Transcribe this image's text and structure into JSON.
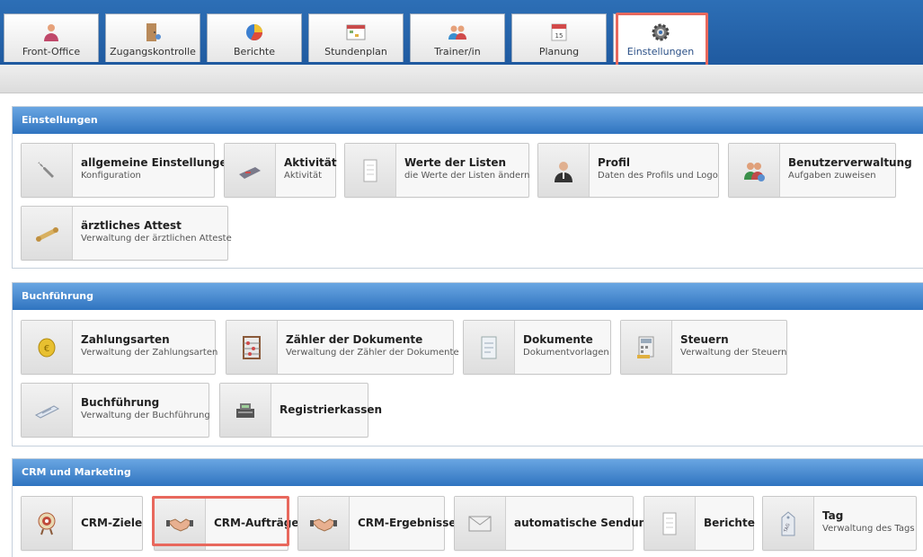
{
  "tabs": [
    {
      "label": "Front-Office",
      "icon": "person-icon"
    },
    {
      "label": "Zugangskontrolle",
      "icon": "door-icon"
    },
    {
      "label": "Berichte",
      "icon": "pie-chart-icon"
    },
    {
      "label": "Stundenplan",
      "icon": "schedule-icon"
    },
    {
      "label": "Trainer/in",
      "icon": "trainers-icon"
    },
    {
      "label": "Planung",
      "icon": "calendar-icon"
    },
    {
      "label": "Einstellungen",
      "icon": "gear-icon",
      "active": true
    }
  ],
  "sections": {
    "einstellungen": {
      "title": "Einstellungen",
      "cards": [
        {
          "title": "allgemeine Einstellungen",
          "subtitle": "Konfiguration",
          "icon": "wrench-icon"
        },
        {
          "title": "Aktivität",
          "subtitle": "Aktivität",
          "icon": "activity-icon"
        },
        {
          "title": "Werte der Listen",
          "subtitle": "die Werte der Listen ändern",
          "icon": "list-values-icon"
        },
        {
          "title": "Profil",
          "subtitle": "Daten des Profils und Logo",
          "icon": "profile-icon"
        },
        {
          "title": "Benutzerverwaltung",
          "subtitle": "Aufgaben zuweisen",
          "icon": "users-icon"
        },
        {
          "title": "ärztliches Attest",
          "subtitle": "Verwaltung der ärztlichen Atteste",
          "icon": "certificate-icon"
        }
      ]
    },
    "buchfuehrung": {
      "title": "Buchführung",
      "cards": [
        {
          "title": "Zahlungsarten",
          "subtitle": "Verwaltung der Zahlungsarten",
          "icon": "coin-icon"
        },
        {
          "title": "Zähler der Dokumente",
          "subtitle": "Verwaltung der Zähler der Dokumente",
          "icon": "abacus-icon"
        },
        {
          "title": "Dokumente",
          "subtitle": "Dokumentvorlagen",
          "icon": "document-icon"
        },
        {
          "title": "Steuern",
          "subtitle": "Verwaltung der Steuern",
          "icon": "calculator-icon"
        },
        {
          "title": "Buchführung",
          "subtitle": "Verwaltung der Buchführung",
          "icon": "ledger-icon"
        },
        {
          "title": "Registrierkassen",
          "subtitle": "",
          "icon": "cash-register-icon"
        }
      ]
    },
    "crm": {
      "title": "CRM und Marketing",
      "cards": [
        {
          "title": "CRM-Ziele",
          "subtitle": "",
          "icon": "target-icon"
        },
        {
          "title": "CRM-Aufträge",
          "subtitle": "",
          "icon": "handshake-icon"
        },
        {
          "title": "CRM-Ergebnisse",
          "subtitle": "",
          "icon": "handshake-icon"
        },
        {
          "title": "automatische Sendung",
          "subtitle": "",
          "icon": "envelope-icon"
        },
        {
          "title": "Berichte",
          "subtitle": "",
          "icon": "report-icon"
        },
        {
          "title": "Tag",
          "subtitle": "Verwaltung des Tags",
          "icon": "tag-icon"
        }
      ]
    }
  },
  "colors": {
    "topbar": "#2568ae",
    "section_header": "#3a7fc8",
    "highlight": "#e8685d"
  }
}
